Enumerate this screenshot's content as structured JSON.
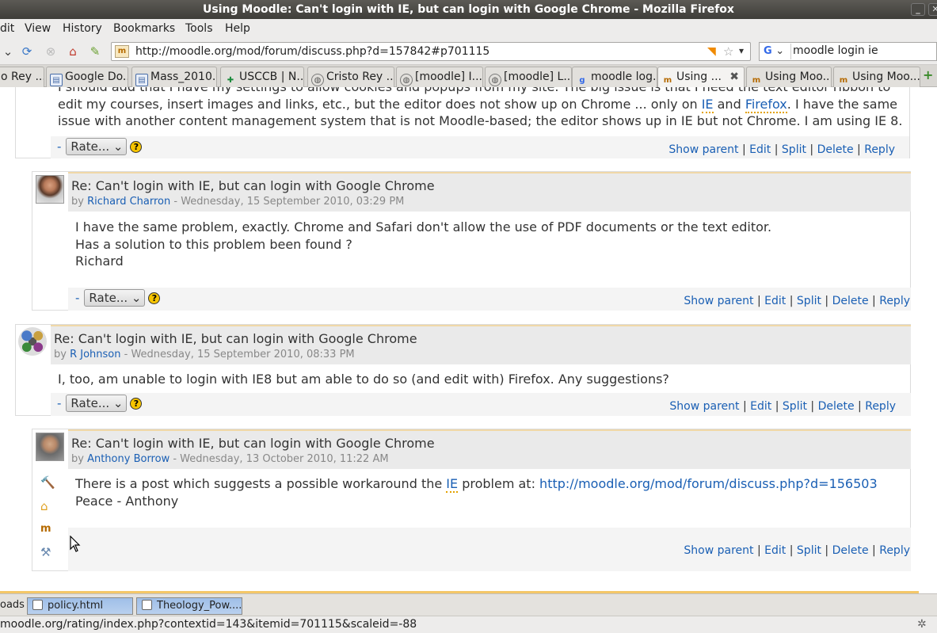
{
  "window": {
    "title": "Using Moodle: Can't login with IE, but can login with Google Chrome - Mozilla Firefox",
    "min": "_",
    "close": "✕"
  },
  "menu": {
    "edit": "dit",
    "view": "View",
    "history": "History",
    "bookmarks": "Bookmarks",
    "tools": "Tools",
    "help": "Help"
  },
  "nav": {
    "url": "http://moodle.org/mod/forum/discuss.php?d=157842#p701115",
    "search_value": "moodle login ie",
    "search_engine": "G"
  },
  "tabs": [
    {
      "label": "o Rey ..."
    },
    {
      "label": "Google Do..."
    },
    {
      "label": "Mass_2010..."
    },
    {
      "label": "USCCB | N..."
    },
    {
      "label": "Cristo Rey ..."
    },
    {
      "label": "[moodle] I..."
    },
    {
      "label": "[moodle] L..."
    },
    {
      "label": "moodle log..."
    },
    {
      "label": "Using ..."
    },
    {
      "label": "Using Moo..."
    },
    {
      "label": "Using Moo..."
    }
  ],
  "newtab": "+",
  "post0": {
    "line1": "I should add that I have my settings to allow cookies and popups from my site.  The big issue is that I need the text editor ribbon to",
    "line2a": "edit my courses, insert images and links, etc., but the editor does not show up on Chrome ... only on ",
    "ie": "IE",
    "and": " and ",
    "firefox": "Firefox",
    "line2b": ". I have the same",
    "line3": "issue with another content management system that is not Moodle-based; the editor shows up in IE but not Chrome.  I am using IE 8."
  },
  "post1": {
    "subject": "Re: Can't login with IE, but can login with Google Chrome",
    "by": "by ",
    "author": "Richard Charron",
    "date": " - Wednesday, 15 September 2010, 03:29 PM",
    "line1": "I have the same problem, exactly. Chrome and Safari don't allow the use of PDF documents or the text editor.",
    "line2": "Has a solution to this problem been found ?",
    "line3": "Richard"
  },
  "post2": {
    "subject": "Re: Can't login with IE, but can login with Google Chrome",
    "by": "by ",
    "author": "R Johnson",
    "date": " - Wednesday, 15 September 2010, 08:33 PM",
    "line1": "I, too, am unable to login with IE8 but am able to do so (and edit with) Firefox. Any suggestions?"
  },
  "post3": {
    "subject": "Re: Can't login with IE, but can login with Google Chrome",
    "by": "by ",
    "author": "Anthony Borrow",
    "date": " - Wednesday, 13 October 2010, 11:22 AM",
    "line1a": "There is a post which suggests a possible workaround the ",
    "ie": "IE",
    "line1b": " problem at: ",
    "link": "http://moodle.org/mod/forum/discuss.php?d=156503",
    "line2": "Peace - Anthony"
  },
  "rate": {
    "dash": "-",
    "label": "Rate...",
    "help": "?"
  },
  "cmds": {
    "show_parent": "Show parent",
    "edit": "Edit",
    "split": "Split",
    "delete": "Delete",
    "reply": "Reply",
    "sep": " | "
  },
  "downloads": {
    "label": "oads",
    "items": [
      "policy.html",
      "Theology_Pow...."
    ]
  },
  "status": "moodle.org/rating/index.php?contextid=143&itemid=701115&scaleid=-88"
}
